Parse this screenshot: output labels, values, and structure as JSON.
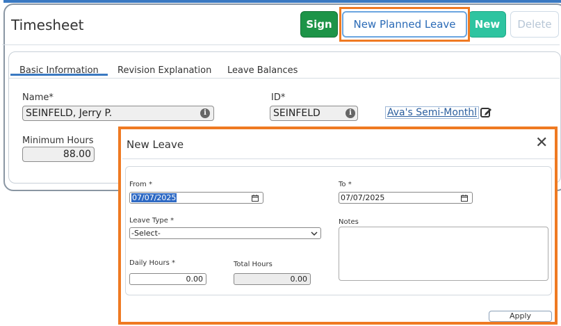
{
  "timesheet": {
    "title": "Timesheet",
    "buttons": {
      "sign": "Sign",
      "new_planned_leave": "New Planned Leave",
      "new": "New",
      "delete": "Delete"
    },
    "tabs": [
      "Basic Information",
      "Revision Explanation",
      "Leave Balances"
    ],
    "active_tab": "Basic Information",
    "fields": {
      "name_label": "Name",
      "name_value": "SEINFELD, Jerry P.",
      "id_label": "ID",
      "id_value": "SEINFELD",
      "schedule_link": "Ava's Semi-Monthl",
      "min_hours_label": "Minimum Hours",
      "min_hours_value": "88.00"
    },
    "required_mark": "*"
  },
  "dialog": {
    "title": "New Leave",
    "close_glyph": "✕",
    "from_label": "From",
    "from_value": "07/07/2025",
    "to_label": "To",
    "to_value": "07/07/2025",
    "leave_type_label": "Leave Type",
    "leave_type_value": "-Select-",
    "notes_label": "Notes",
    "notes_value": "",
    "daily_hours_label": "Daily Hours",
    "daily_hours_value": "0.00",
    "total_hours_label": "Total Hours",
    "total_hours_value": "0.00",
    "apply_label": "Apply",
    "required_mark": "*"
  },
  "colors": {
    "accent_blue": "#3a79c2",
    "highlight_orange": "#ef7a22",
    "sign_green": "#1d9448",
    "new_teal": "#2ec4a0"
  },
  "icons": {
    "info": "info-icon",
    "edit": "edit-icon",
    "calendar": "calendar-icon",
    "chevron": "chevron-down-icon",
    "close": "close-icon"
  }
}
